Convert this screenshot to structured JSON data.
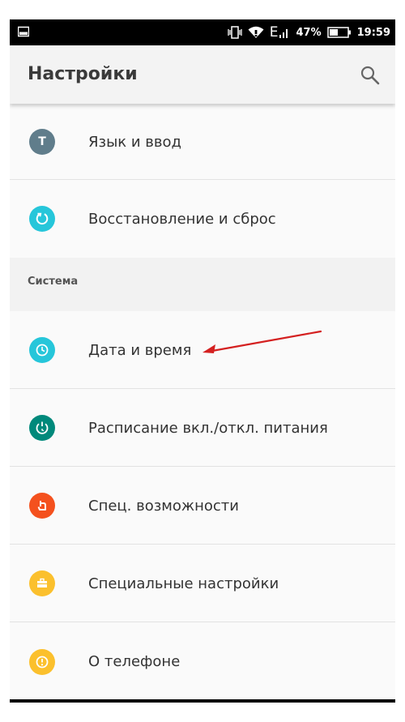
{
  "status_bar": {
    "battery_percent": "47%",
    "network_type": "E",
    "time": "19:59",
    "battery_level": 0.47
  },
  "toolbar": {
    "title": "Настройки",
    "search_icon": "search-icon"
  },
  "settings_list": {
    "items_top": [
      {
        "label": "Язык и ввод",
        "icon": "T",
        "color": "#607d8b"
      },
      {
        "label": "Восстановление и сброс",
        "icon": "restore-icon",
        "color": "#26c6da"
      }
    ],
    "section_header": "Система",
    "items_system": [
      {
        "label": "Дата и время",
        "icon": "clock-icon",
        "color": "#26c6da"
      },
      {
        "label": "Расписание вкл./откл. питания",
        "icon": "power-schedule-icon",
        "color": "#00897b"
      },
      {
        "label": "Спец. возможности",
        "icon": "accessibility-icon",
        "color": "#f4511e"
      },
      {
        "label": "Специальные настройки",
        "icon": "briefcase-icon",
        "color": "#fbc02d"
      },
      {
        "label": "О телефоне",
        "icon": "info-icon",
        "color": "#fbc02d"
      }
    ]
  },
  "colors": {
    "status_bar_bg": "#000000",
    "toolbar_bg": "#f3f3f3",
    "list_bg": "#fafafa",
    "section_bg": "#f2f2f2",
    "annotation_arrow": "#d42020"
  }
}
